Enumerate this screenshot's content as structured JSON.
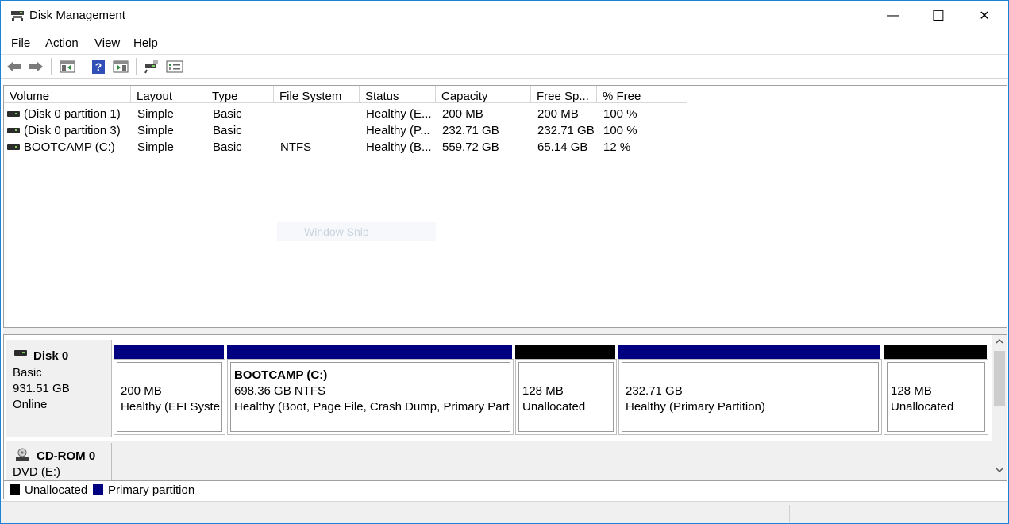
{
  "window": {
    "title": "Disk Management",
    "controls": {
      "minimize": "—",
      "maximize": "☐",
      "close": "✕"
    }
  },
  "menu": [
    "File",
    "Action",
    "View",
    "Help"
  ],
  "toolbar": {
    "buttons": [
      "back-arrow-icon",
      "forward-arrow-icon",
      "show-hide-console-tree-icon",
      "help-icon",
      "show-hide-action-pane-icon",
      "connect-virtual-disk-icon",
      "properties-icon"
    ]
  },
  "volume_list": {
    "columns": [
      "Volume",
      "Layout",
      "Type",
      "File System",
      "Status",
      "Capacity",
      "Free Sp...",
      "% Free"
    ],
    "rows": [
      {
        "volume": "(Disk 0 partition 1)",
        "layout": "Simple",
        "type": "Basic",
        "fs": "",
        "status": "Healthy (E...",
        "capacity": "200 MB",
        "free": "200 MB",
        "pct": "100 %"
      },
      {
        "volume": "(Disk 0 partition 3)",
        "layout": "Simple",
        "type": "Basic",
        "fs": "",
        "status": "Healthy (P...",
        "capacity": "232.71 GB",
        "free": "232.71 GB",
        "pct": "100 %"
      },
      {
        "volume": "BOOTCAMP (C:)",
        "layout": "Simple",
        "type": "Basic",
        "fs": "NTFS",
        "status": "Healthy (B...",
        "capacity": "559.72 GB",
        "free": "65.14 GB",
        "pct": "12 %"
      }
    ],
    "ghost_text": "Window Snip"
  },
  "disks": [
    {
      "name": "Disk 0",
      "kind": "Basic",
      "size": "931.51 GB",
      "state": "Online",
      "partitions": [
        {
          "title": "",
          "line1": "200 MB",
          "line2": "Healthy (EFI System Partition)",
          "color": "#000080"
        },
        {
          "title": "BOOTCAMP  (C:)",
          "line1": "698.36 GB NTFS",
          "line2": "Healthy (Boot, Page File, Crash Dump, Primary Partition)",
          "color": "#000080"
        },
        {
          "title": "",
          "line1": "128 MB",
          "line2": "Unallocated",
          "color": "#000000"
        },
        {
          "title": "",
          "line1": "232.71 GB",
          "line2": "Healthy (Primary Partition)",
          "color": "#000080"
        },
        {
          "title": "",
          "line1": "128 MB",
          "line2": "Unallocated",
          "color": "#000000"
        }
      ]
    },
    {
      "name": "CD-ROM 0",
      "kind": "DVD (E:)"
    }
  ],
  "legend": [
    {
      "label": "Unallocated",
      "color": "#000000"
    },
    {
      "label": "Primary partition",
      "color": "#000080"
    }
  ],
  "colors": {
    "primary": "#000080",
    "unallocated": "#000000",
    "accent": "#1883d7"
  }
}
